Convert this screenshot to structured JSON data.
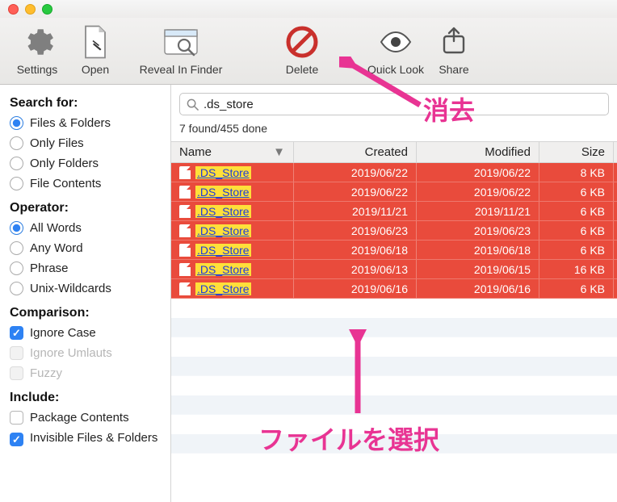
{
  "toolbar": {
    "settings": "Settings",
    "open": "Open",
    "reveal": "Reveal In Finder",
    "delete": "Delete",
    "quicklook": "Quick Look",
    "share": "Share"
  },
  "sidebar": {
    "search_for": "Search for:",
    "search_opts": [
      "Files & Folders",
      "Only Files",
      "Only Folders",
      "File Contents"
    ],
    "search_sel": 0,
    "operator": "Operator:",
    "op_opts": [
      "All Words",
      "Any Word",
      "Phrase",
      "Unix-Wildcards"
    ],
    "op_sel": 0,
    "comparison": "Comparison:",
    "cmp_ignore_case": "Ignore Case",
    "cmp_ignore_umlauts": "Ignore Umlauts",
    "cmp_fuzzy": "Fuzzy",
    "include": "Include:",
    "inc_package": "Package Contents",
    "inc_invisible": "Invisible Files & Folders"
  },
  "search": {
    "value": ".ds_store",
    "status": "7 found/455 done"
  },
  "columns": {
    "name": "Name",
    "created": "Created",
    "modified": "Modified",
    "size": "Size"
  },
  "rows": [
    {
      "name": ".DS_Store",
      "created": "2019/06/22",
      "modified": "2019/06/22",
      "size": "8 KB"
    },
    {
      "name": ".DS_Store",
      "created": "2019/06/22",
      "modified": "2019/06/22",
      "size": "6 KB"
    },
    {
      "name": ".DS_Store",
      "created": "2019/11/21",
      "modified": "2019/11/21",
      "size": "6 KB"
    },
    {
      "name": ".DS_Store",
      "created": "2019/06/23",
      "modified": "2019/06/23",
      "size": "6 KB"
    },
    {
      "name": ".DS_Store",
      "created": "2019/06/18",
      "modified": "2019/06/18",
      "size": "6 KB"
    },
    {
      "name": ".DS_Store",
      "created": "2019/06/13",
      "modified": "2019/06/15",
      "size": "16 KB"
    },
    {
      "name": ".DS_Store",
      "created": "2019/06/16",
      "modified": "2019/06/16",
      "size": "6 KB"
    }
  ],
  "annotations": {
    "delete": "消去",
    "select": "ファイルを選択"
  },
  "colors": {
    "accent": "#2e82f3",
    "select_bg": "#e94b3c",
    "anno": "#e83493"
  }
}
